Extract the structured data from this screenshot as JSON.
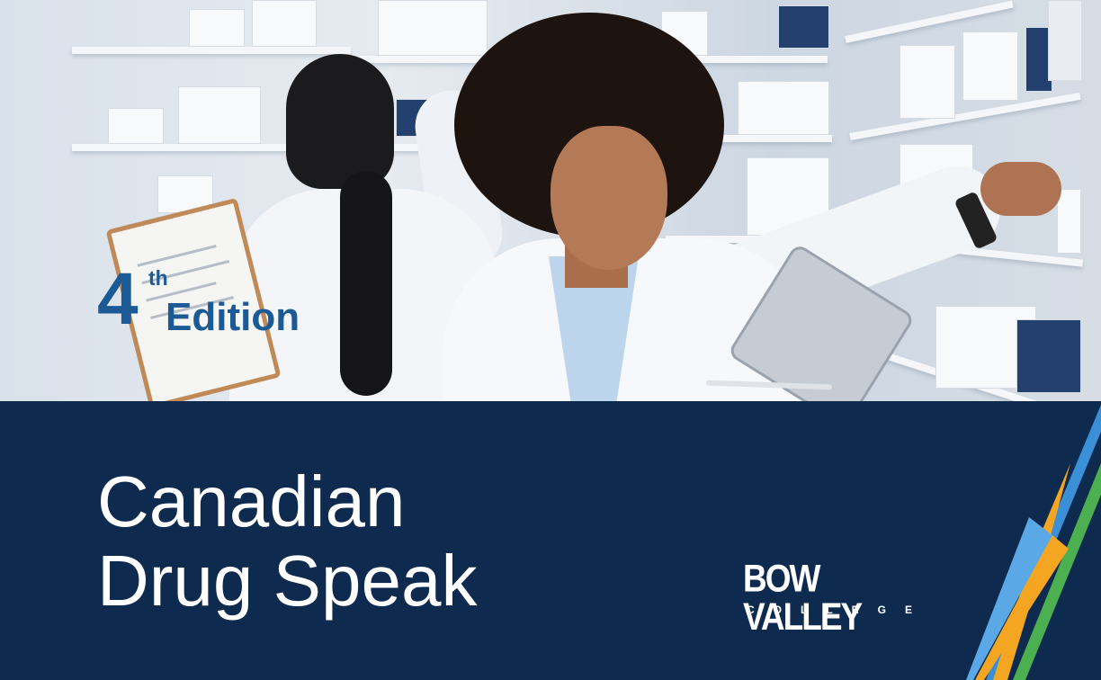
{
  "edition": {
    "number": "4",
    "suffix": "th",
    "label": "Edition"
  },
  "title": {
    "line1": "Canadian",
    "line2": "Drug Speak"
  },
  "logo": {
    "name": "BOW VALLEY",
    "subtitle": "COLLEGE"
  },
  "colors": {
    "navy": "#0f2a4f",
    "edition_blue": "#1b5a94",
    "stripe_yellow": "#f4a521",
    "stripe_blue": "#3a8fd6",
    "stripe_green": "#4caf50"
  },
  "photo": {
    "icon": "pharmacists-photo"
  }
}
